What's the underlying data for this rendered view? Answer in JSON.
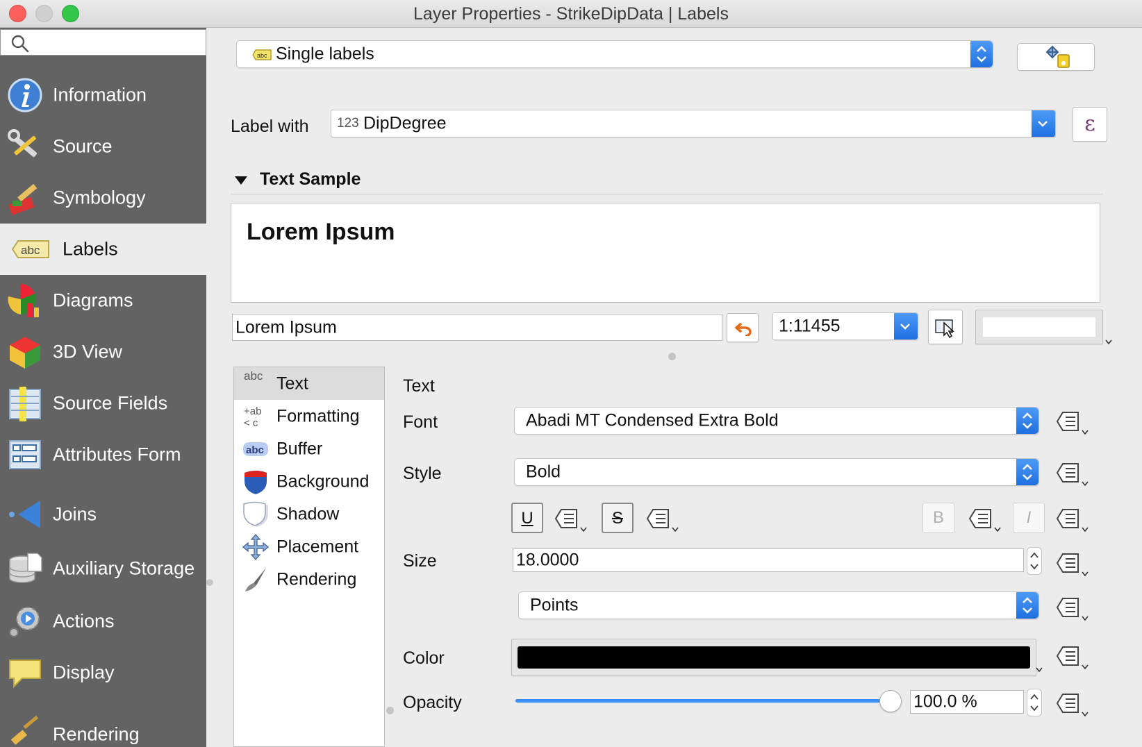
{
  "window": {
    "title": "Layer Properties - StrikeDipData | Labels"
  },
  "sidebar": {
    "search_placeholder": "",
    "items": [
      {
        "label": "Information",
        "icon": "info-icon"
      },
      {
        "label": "Source",
        "icon": "wrench-screwdriver-icon"
      },
      {
        "label": "Symbology",
        "icon": "paintbrush-icon"
      },
      {
        "label": "Labels",
        "icon": "abc-label-icon",
        "selected": true
      },
      {
        "label": "Diagrams",
        "icon": "diagram-chart-icon"
      },
      {
        "label": "3D View",
        "icon": "cube-icon"
      },
      {
        "label": "Source Fields",
        "icon": "fields-table-icon"
      },
      {
        "label": "Attributes Form",
        "icon": "form-icon"
      },
      {
        "label": "Joins",
        "icon": "join-icon"
      },
      {
        "label": "Auxiliary Storage",
        "icon": "database-icon"
      },
      {
        "label": "Actions",
        "icon": "actions-gear-icon"
      },
      {
        "label": "Display",
        "icon": "speech-bubble-icon"
      },
      {
        "label": "Rendering",
        "icon": "rendering-brush-icon"
      }
    ]
  },
  "labeling": {
    "mode": "Single labels",
    "label_with_caption": "Label with",
    "field_type": "123",
    "field": "DipDegree",
    "expression_symbol": "ε"
  },
  "text_sample": {
    "header": "Text Sample",
    "preview_text": "Lorem Ipsum",
    "input_value": "Lorem Ipsum",
    "scale": "1:11455"
  },
  "tabs": [
    {
      "label": "Text",
      "icon": "abc-text-icon",
      "selected": true
    },
    {
      "label": "Formatting",
      "icon": "formatting-icon"
    },
    {
      "label": "Buffer",
      "icon": "buffer-abc-icon"
    },
    {
      "label": "Background",
      "icon": "shield-background-icon"
    },
    {
      "label": "Shadow",
      "icon": "shadow-shield-icon"
    },
    {
      "label": "Placement",
      "icon": "placement-arrows-icon"
    },
    {
      "label": "Rendering",
      "icon": "rendering-brush-icon"
    }
  ],
  "text_panel": {
    "section_title": "Text",
    "font_label": "Font",
    "font_value": "Abadi MT Condensed Extra Bold",
    "style_label": "Style",
    "style_value": "Bold",
    "underline_label": "U",
    "strikeout_label": "S",
    "bold_label": "B",
    "italic_label": "I",
    "size_label": "Size",
    "size_value": "18.0000",
    "unit_value": "Points",
    "color_label": "Color",
    "color_value": "#000000",
    "opacity_label": "Opacity",
    "opacity_text": "100.0 %",
    "opacity_fraction": 1.0
  },
  "colors": {
    "sidebar_bg": "#636363",
    "accent_blue": "#2c7ef0",
    "selected_bg": "#ececec"
  }
}
